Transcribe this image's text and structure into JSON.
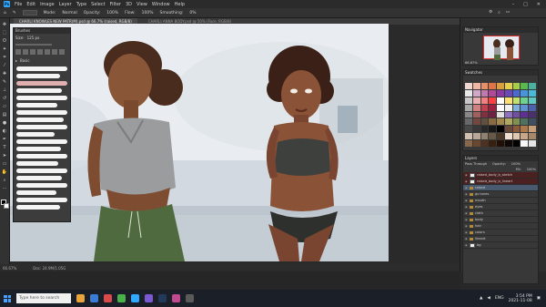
{
  "app": {
    "name": "Ps"
  },
  "menu": {
    "items": [
      "File",
      "Edit",
      "Image",
      "Layer",
      "Type",
      "Select",
      "Filter",
      "3D",
      "View",
      "Window",
      "Help"
    ]
  },
  "options_bar": {
    "mode_label": "Mode:",
    "mode": "Normal",
    "opacity_label": "Opacity:",
    "opacity": "100%",
    "flow_label": "Flow:",
    "flow": "100%",
    "smoothing_label": "Smoothing:",
    "smoothing": "0%"
  },
  "tabs": [
    {
      "label": "CHARLI KNOWLES NEW PATR(M).psd @ 66.7% (raised, RGB/8)"
    },
    {
      "label": "CHARLI ANNA BODY.psd @ 50% (Face, RGB/8)"
    }
  ],
  "status": {
    "zoom": "66.67%",
    "doc": "Doc: 24.9M/1.05G"
  },
  "brush_panel": {
    "title": "Brushes",
    "size_label": "Size:",
    "size_value": "125 px",
    "folder": "Basic"
  },
  "navigator": {
    "title": "Navigator",
    "zoom": "66.67%"
  },
  "swatches": {
    "title": "Swatches"
  },
  "swatch_colors": [
    "#f2d7d0",
    "#f0b7a4",
    "#e6906a",
    "#e07447",
    "#d8a040",
    "#e6d04a",
    "#a6cc4a",
    "#5ab850",
    "#4ab0a0",
    "#e8e8e8",
    "#d0a8c8",
    "#c07ab0",
    "#b04a98",
    "#8a3aa0",
    "#6a4ab8",
    "#4a6ad0",
    "#4a94d8",
    "#4ab8d8",
    "#c8c8c8",
    "#e8b0b0",
    "#f08080",
    "#ff4040",
    "#ffffff",
    "#ffe070",
    "#c0e070",
    "#70d090",
    "#60c8c0",
    "#a8a8a8",
    "#d08080",
    "#c04050",
    "#a02040",
    "#ffffff",
    "#f0f0f0",
    "#80b0e0",
    "#6090d0",
    "#5060b0",
    "#888888",
    "#a06060",
    "#803040",
    "#702040",
    "#e0e0e0",
    "#9070c0",
    "#7050a0",
    "#603090",
    "#4a3070",
    "#686868",
    "#704840",
    "#605040",
    "#8a6a40",
    "#a08850",
    "#b0a860",
    "#809050",
    "#507060",
    "#405060",
    "#484848",
    "#383838",
    "#282828",
    "#181818",
    "#000000",
    "#6a4a3a",
    "#8a5a3a",
    "#aa7a4a",
    "#caa07a",
    "#d0c0b0",
    "#b8a898",
    "#908070",
    "#685848",
    "#483828",
    "#f0e0d0",
    "#e0c8b0",
    "#c8a888",
    "#a88868",
    "#886848",
    "#684830",
    "#503020",
    "#382010",
    "#201008",
    "#100804",
    "#000000",
    "#f8f8f8",
    "#e4e4e4"
  ],
  "layers_panel": {
    "title": "Layers",
    "blend": "Pass Through",
    "opacity_label": "Opacity:",
    "opacity": "100%",
    "fill_label": "Fill:",
    "fill": "100%"
  },
  "layers": [
    {
      "name": "raised_body_b_sketch",
      "kind": "layer",
      "state": "red"
    },
    {
      "name": "raised_body_b_lineart",
      "kind": "layer",
      "state": "red"
    },
    {
      "name": "raised",
      "kind": "folder",
      "state": "sel"
    },
    {
      "name": "gs tones",
      "kind": "folder",
      "state": ""
    },
    {
      "name": "mouth",
      "kind": "folder",
      "state": ""
    },
    {
      "name": "eyes",
      "kind": "folder",
      "state": ""
    },
    {
      "name": "cloth",
      "kind": "folder",
      "state": ""
    },
    {
      "name": "body",
      "kind": "folder",
      "state": ""
    },
    {
      "name": "hair",
      "kind": "folder",
      "state": ""
    },
    {
      "name": "colors",
      "kind": "folder",
      "state": ""
    },
    {
      "name": "lineart",
      "kind": "folder",
      "state": ""
    },
    {
      "name": "bg",
      "kind": "layer",
      "state": ""
    }
  ],
  "taskbar": {
    "search": "Type here to search",
    "time": "3:54 PM",
    "date": "2021-11-08",
    "lang": "ENG"
  }
}
